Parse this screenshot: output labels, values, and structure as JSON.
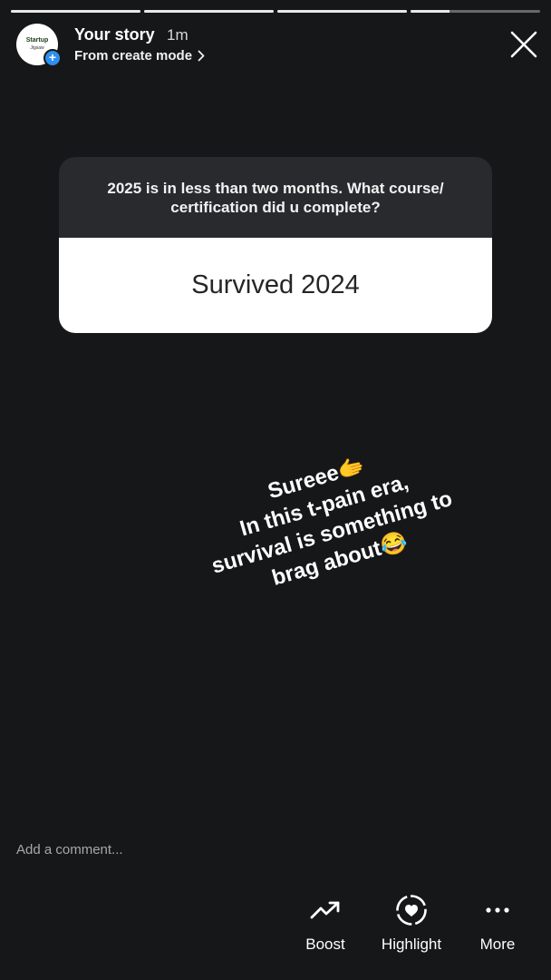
{
  "progress": {
    "segments": [
      1,
      1,
      1,
      0.3
    ]
  },
  "header": {
    "avatar_text": "Startup",
    "avatar_subtext": "Jigsaw",
    "title": "Your story",
    "time": "1m",
    "subtitle": "From create mode",
    "subtitle_chevron": "›"
  },
  "question_card": {
    "question": "2025 is in less than two months. What course/ certification did u complete?",
    "answer": "Survived 2024"
  },
  "caption": {
    "text": "Sureee🫱\nIn this t-pain era,\nsurvival is something to\nbrag about😂"
  },
  "comment": {
    "placeholder": "Add a comment..."
  },
  "actions": {
    "boost": "Boost",
    "highlight": "Highlight",
    "more": "More"
  },
  "icons": {
    "close": "close-icon",
    "boost": "trending-up-icon",
    "highlight": "heart-circle-icon",
    "more": "more-dots-icon",
    "add": "plus-icon",
    "chevron": "chevron-right-icon"
  },
  "colors": {
    "background": "#161718",
    "card_question_bg": "#282a2e",
    "card_answer_bg": "#ffffff",
    "accent_blue": "#2e8ff0"
  }
}
